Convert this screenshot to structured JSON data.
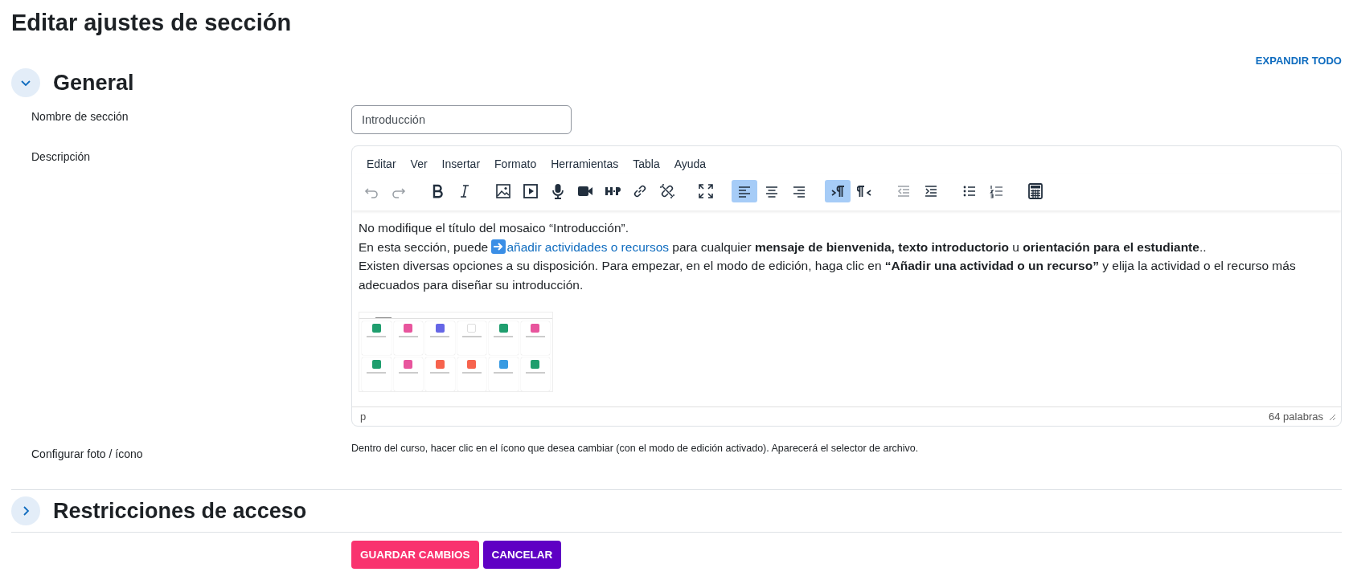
{
  "page_title": "Editar ajustes de sección",
  "expand_all": "EXPANDIR TODO",
  "sections": [
    {
      "title": "General",
      "expanded": true
    },
    {
      "title": "Restricciones de acceso",
      "expanded": false
    }
  ],
  "fields": {
    "name_label": "Nombre de sección",
    "name_value": "Introducción",
    "description_label": "Descripción",
    "photo_label": "Configurar foto / ícono",
    "photo_hint": "Dentro del curso, hacer clic en el ícono que desea cambiar (con el modo de edición activado). Aparecerá el selector de archivo."
  },
  "editor": {
    "menu": [
      "Editar",
      "Ver",
      "Insertar",
      "Formato",
      "Herramientas",
      "Tabla",
      "Ayuda"
    ],
    "toolbar": [
      [
        {
          "kind": "undo",
          "selected": false,
          "disabled": true
        },
        {
          "kind": "redo",
          "selected": false,
          "disabled": true
        }
      ],
      [
        {
          "kind": "bold",
          "selected": false,
          "disabled": false
        },
        {
          "kind": "italic",
          "selected": false,
          "disabled": false
        }
      ],
      [
        {
          "kind": "image",
          "selected": false,
          "disabled": false
        },
        {
          "kind": "media",
          "selected": false,
          "disabled": false
        },
        {
          "kind": "mic",
          "selected": false,
          "disabled": false
        },
        {
          "kind": "video",
          "selected": false,
          "disabled": false
        },
        {
          "kind": "hp",
          "selected": false,
          "disabled": false
        },
        {
          "kind": "link",
          "selected": false,
          "disabled": false
        },
        {
          "kind": "unlink",
          "selected": false,
          "disabled": false
        }
      ],
      [
        {
          "kind": "fullscreen",
          "selected": false,
          "disabled": false
        }
      ],
      [
        {
          "kind": "alignleft",
          "selected": true,
          "disabled": false
        },
        {
          "kind": "aligncenter",
          "selected": false,
          "disabled": false
        },
        {
          "kind": "alignright",
          "selected": false,
          "disabled": false
        }
      ],
      [
        {
          "kind": "ltr",
          "selected": true,
          "disabled": false
        },
        {
          "kind": "rtl",
          "selected": false,
          "disabled": false
        }
      ],
      [
        {
          "kind": "outdent",
          "selected": false,
          "disabled": true
        },
        {
          "kind": "indent",
          "selected": false,
          "disabled": false
        }
      ],
      [
        {
          "kind": "bullets",
          "selected": false,
          "disabled": false
        },
        {
          "kind": "numbers",
          "selected": false,
          "disabled": false
        }
      ],
      [
        {
          "kind": "calculator",
          "selected": false,
          "disabled": false
        }
      ]
    ],
    "lines": [
      {
        "before": "No modifique el título del mosaico “Introducción”."
      },
      {
        "before": "En esta sección, puede ",
        "link": "añadir actividades o recursos",
        "after": " para cualquier **mensaje de bienvenida, texto introductorio** u **orientación para el estudiante**.."
      },
      {
        "before": "Existen diversas opciones a su disposición. Para empezar, en el modo de edición, haga clic en **“Añadir una actividad o un recurso”** y elija la actividad o el recurso más adecuados para diseñar su introducción."
      }
    ],
    "path": "p",
    "word_count": "64 palabras"
  },
  "buttons": [
    {
      "label": "GUARDAR CAMBIOS",
      "kind": "primary"
    },
    {
      "label": "CANCELAR",
      "kind": "secondary"
    }
  ]
}
